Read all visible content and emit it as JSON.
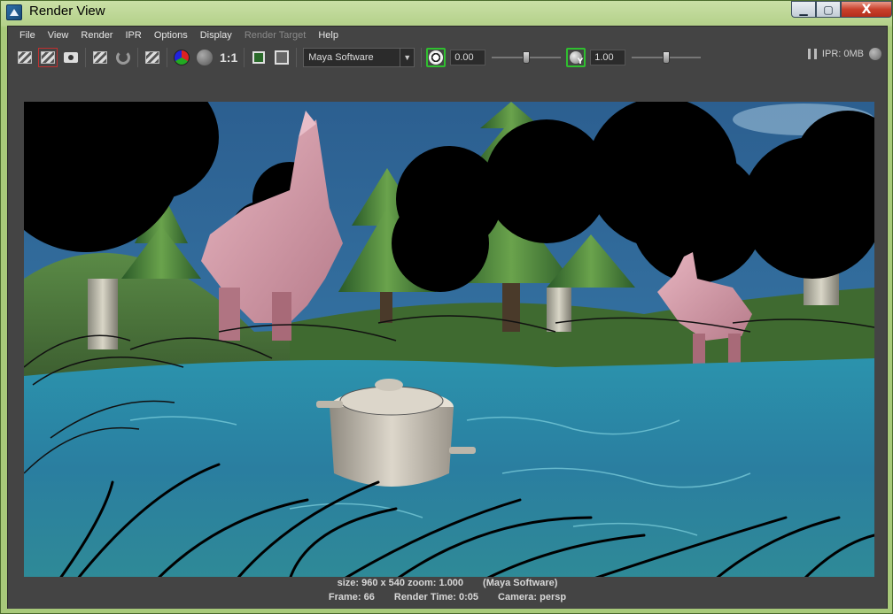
{
  "window": {
    "title": "Render View",
    "controls": {
      "minimize": "▁",
      "maximize": "▢",
      "close": "X"
    }
  },
  "menu": [
    "File",
    "View",
    "Render",
    "IPR",
    "Options",
    "Display",
    "Render Target",
    "Help"
  ],
  "toolbar": {
    "ratio_label": "1:1",
    "renderer": "Maya Software",
    "exposure_value": "0.00",
    "gamma_value": "1.00",
    "exposure_level": 0.5,
    "gamma_level": 0.5,
    "ipr_label": "IPR: 0MB",
    "icons": [
      "render-frame-icon",
      "render-region-icon",
      "snapshot-icon",
      "ipr-render-icon",
      "refresh-icon",
      "render-sequence-icon",
      "rgb-channels-icon",
      "alpha-channel-icon",
      "display-frame-icon",
      "keep-image-icon",
      "exposure-icon",
      "gamma-icon",
      "pause-icon",
      "ipr-status-icon"
    ]
  },
  "status": {
    "size_zoom": "size: 960 x 540 zoom: 1.000",
    "renderer": "(Maya Software)",
    "frame": "Frame: 66",
    "render_time": "Render Time: 0:05",
    "camera": "Camera: persp"
  },
  "scene_colors": {
    "sky": "#2e6797",
    "water": "#2f8fa8",
    "grass": "#4e7a3a",
    "tree_green": "#3f7a34",
    "donkey_pink": "#d8a0ad",
    "pot": "#cdc7bb"
  }
}
